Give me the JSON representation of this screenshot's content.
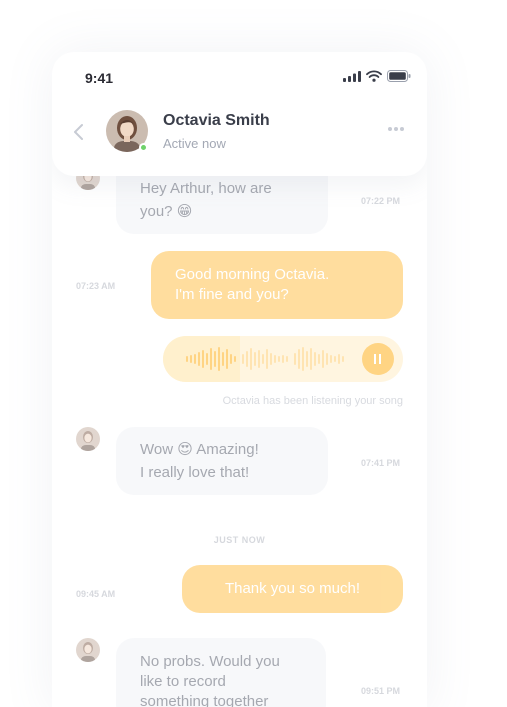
{
  "status_bar": {
    "time": "9:41"
  },
  "header": {
    "contact_name": "Octavia Smith",
    "contact_status": "Active now"
  },
  "messages": [
    {
      "direction": "incoming",
      "text_lines": [
        "Hey Arthur, how are",
        "you? 😁"
      ],
      "time": "07:22 PM"
    },
    {
      "direction": "outgoing",
      "text_lines": [
        "Good morning Octavia.",
        "I'm fine and you?"
      ],
      "time": "07:23 AM"
    },
    {
      "direction": "outgoing",
      "type": "voice",
      "progress": 0.32,
      "note": "Octavia has been listening your song"
    },
    {
      "direction": "incoming",
      "text_lines": [
        "Wow 😍 Amazing!",
        "I really love that!"
      ],
      "time": "07:41 PM"
    },
    {
      "direction": "outgoing",
      "text_lines": [
        "Thank you so much!"
      ],
      "time": "09:45 AM"
    },
    {
      "direction": "incoming",
      "text_lines": [
        "No probs. Would you",
        "like to record",
        "something together"
      ],
      "time": "09:51 PM"
    }
  ],
  "day_separator": "JUST NOW",
  "colors": {
    "accent": "#ffc24f",
    "incoming_bubble": "#f1f3f7",
    "online": "#6fd26a"
  },
  "icons": [
    "chevron-left-icon",
    "more-icon",
    "signal-icon",
    "wifi-icon",
    "battery-icon",
    "pause-icon"
  ]
}
